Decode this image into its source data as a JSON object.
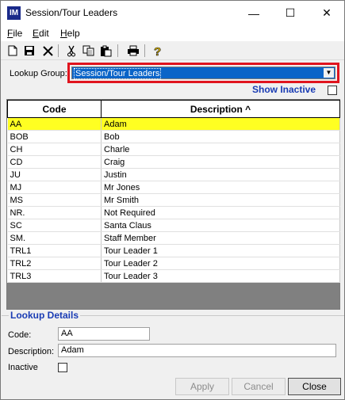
{
  "window": {
    "title": "Session/Tour Leaders",
    "app_icon_text": "IM"
  },
  "window_controls": {
    "minimize": "—",
    "maximize": "☐",
    "close": "✕"
  },
  "menu": [
    {
      "label": "File",
      "mnemonic": "F"
    },
    {
      "label": "Edit",
      "mnemonic": "E"
    },
    {
      "label": "Help",
      "mnemonic": "H"
    }
  ],
  "toolbar": {
    "icons": [
      "new-icon",
      "save-icon",
      "delete-icon",
      "cut-icon",
      "copy-icon",
      "paste-icon",
      "print-icon",
      "help-icon"
    ]
  },
  "lookup": {
    "label": "Lookup Group:",
    "value": "Session/Tour Leaders"
  },
  "show_inactive": {
    "label": "Show Inactive",
    "checked": false
  },
  "grid": {
    "columns": [
      "Code",
      "Description ^"
    ],
    "rows": [
      {
        "code": "AA",
        "description": "Adam",
        "selected": true
      },
      {
        "code": "BOB",
        "description": "Bob"
      },
      {
        "code": "CH",
        "description": "Charle"
      },
      {
        "code": "CD",
        "description": "Craig"
      },
      {
        "code": "JU",
        "description": "Justin"
      },
      {
        "code": "MJ",
        "description": "Mr Jones"
      },
      {
        "code": "MS",
        "description": "Mr Smith"
      },
      {
        "code": "NR.",
        "description": "Not Required"
      },
      {
        "code": "SC",
        "description": "Santa Claus"
      },
      {
        "code": "SM.",
        "description": "Staff Member"
      },
      {
        "code": "TRL1",
        "description": "Tour Leader 1"
      },
      {
        "code": "TRL2",
        "description": "Tour Leader 2"
      },
      {
        "code": "TRL3",
        "description": "Tour Leader 3"
      }
    ]
  },
  "details": {
    "title": "Lookup Details",
    "code_label": "Code:",
    "code_value": "AA",
    "description_label": "Description:",
    "description_value": "Adam",
    "inactive_label": "Inactive",
    "inactive_checked": false
  },
  "buttons": {
    "apply": "Apply",
    "cancel": "Cancel",
    "close": "Close"
  },
  "colors": {
    "selected_row": "#ffff22",
    "dropdown_highlight": "#0a64c8",
    "annotation_box": "#e0141e",
    "group_title": "#1a3cb4"
  }
}
